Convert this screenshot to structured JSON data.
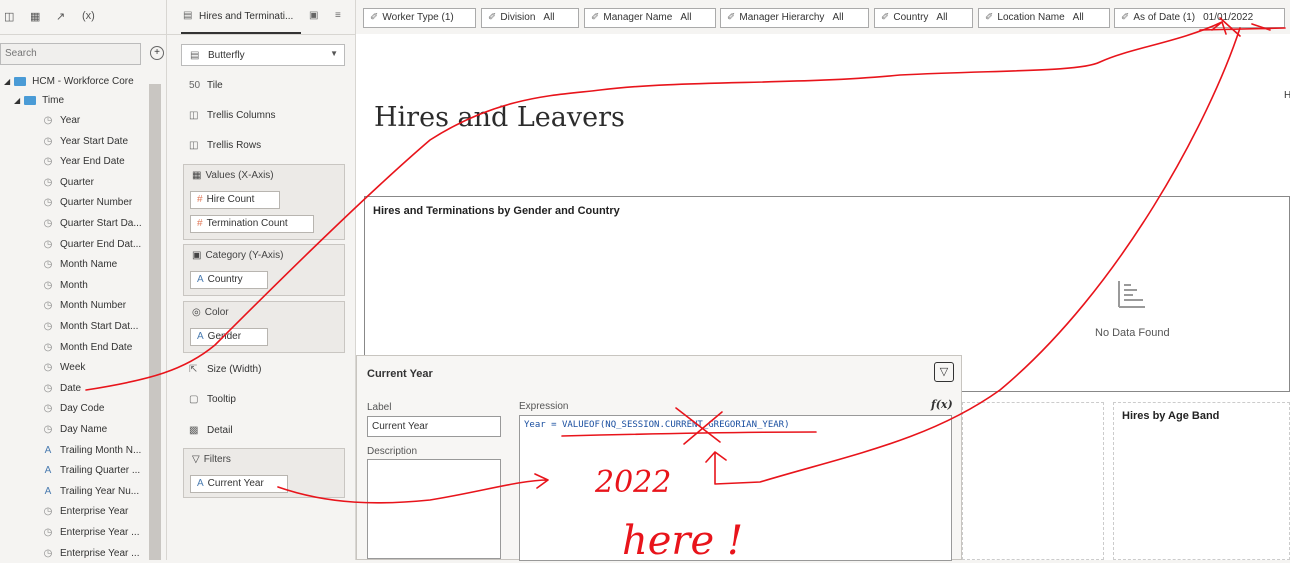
{
  "data_panel": {
    "search_placeholder": "Search",
    "root": "HCM - Workforce Core",
    "folder": "Time",
    "items": [
      {
        "label": "Year",
        "icon": "clock-icon"
      },
      {
        "label": "Year Start Date",
        "icon": "clock-icon"
      },
      {
        "label": "Year End Date",
        "icon": "clock-icon"
      },
      {
        "label": "Quarter",
        "icon": "clock-icon"
      },
      {
        "label": "Quarter Number",
        "icon": "clock-icon"
      },
      {
        "label": "Quarter Start Da...",
        "icon": "clock-icon"
      },
      {
        "label": "Quarter End Dat...",
        "icon": "clock-icon"
      },
      {
        "label": "Month Name",
        "icon": "clock-icon"
      },
      {
        "label": "Month",
        "icon": "clock-icon"
      },
      {
        "label": "Month Number",
        "icon": "clock-icon"
      },
      {
        "label": "Month Start Dat...",
        "icon": "clock-icon"
      },
      {
        "label": "Month End Date",
        "icon": "clock-icon"
      },
      {
        "label": "Week",
        "icon": "clock-icon"
      },
      {
        "label": "Date",
        "icon": "clock-icon"
      },
      {
        "label": "Day Code",
        "icon": "clock-icon"
      },
      {
        "label": "Day Name",
        "icon": "clock-icon"
      },
      {
        "label": "Trailing Month N...",
        "icon": "text-attribute-icon"
      },
      {
        "label": "Trailing Quarter ...",
        "icon": "text-attribute-icon"
      },
      {
        "label": "Trailing Year Nu...",
        "icon": "text-attribute-icon"
      },
      {
        "label": "Enterprise Year",
        "icon": "clock-icon"
      },
      {
        "label": "Enterprise Year ...",
        "icon": "clock-icon"
      },
      {
        "label": "Enterprise Year ...",
        "icon": "clock-icon"
      }
    ]
  },
  "grammar": {
    "tab_label": "Hires and Terminati...",
    "chart_type": "Butterfly",
    "tile": "Tile",
    "trellis_columns": "Trellis Columns",
    "trellis_rows": "Trellis Rows",
    "values_zone": "Values (X-Axis)",
    "values_pills": [
      "Hire Count",
      "Termination Count"
    ],
    "category_zone": "Category (Y-Axis)",
    "category_pill": "Country",
    "color_zone": "Color",
    "color_pill": "Gender",
    "size": "Size (Width)",
    "tooltip": "Tooltip",
    "detail": "Detail",
    "filters_zone": "Filters",
    "filters_pill": "Current Year"
  },
  "filter_bar": [
    {
      "label": "Worker Type (1)",
      "value": ""
    },
    {
      "label": "Division",
      "value": "All"
    },
    {
      "label": "Manager Name",
      "value": "All"
    },
    {
      "label": "Manager Hierarchy",
      "value": "All"
    },
    {
      "label": "Country",
      "value": "All"
    },
    {
      "label": "Location Name",
      "value": "All"
    },
    {
      "label": "As of Date (1)",
      "value": "01/01/2022"
    }
  ],
  "canvas": {
    "page_title": "Hires and Leavers",
    "viz1_title": "Hires and Terminations by Gender and Country",
    "no_data": "No Data Found",
    "viz3_title": "Hires by Age Band",
    "edge_char": "H"
  },
  "dialog": {
    "title": "Current Year",
    "label_caption": "Label",
    "label_value": "Current Year",
    "description_caption": "Description",
    "expression_caption": "Expression",
    "fx_label": "f(x)",
    "expr_lhs": "Year = ",
    "expr_fn": "VALUEOF",
    "expr_arg": "(NQ_SESSION.CURRENT_GREGORIAN_YEAR)"
  },
  "annotation": {
    "handwriting": [
      "2022",
      "here !"
    ],
    "color": "#e8141b"
  }
}
